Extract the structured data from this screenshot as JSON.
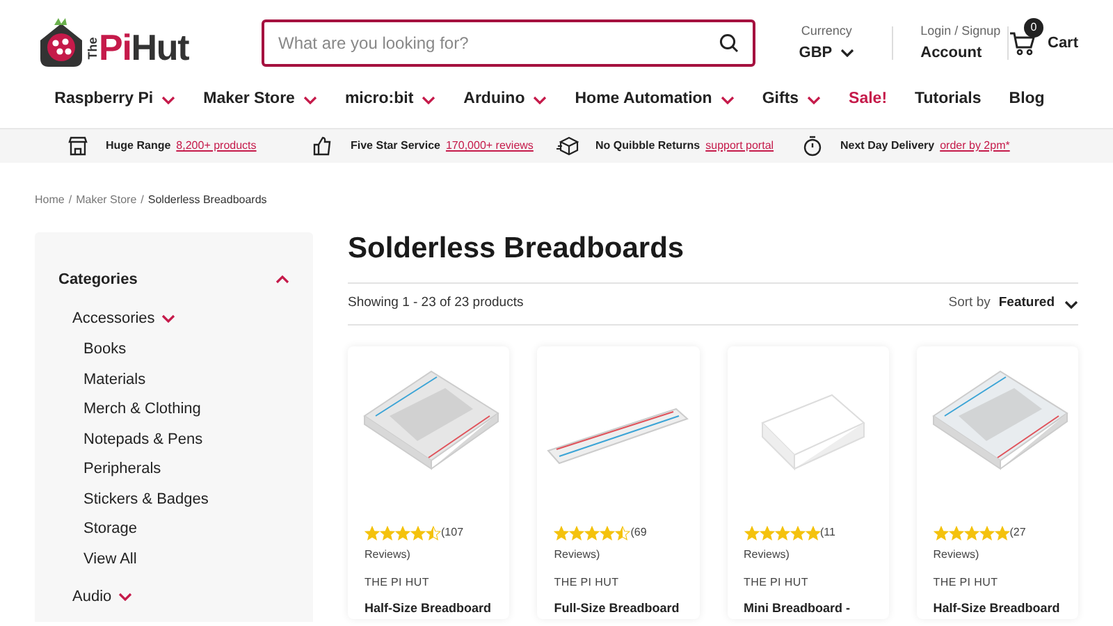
{
  "logo": {
    "prefix": "The",
    "pi": "Pi",
    "hut": "Hut"
  },
  "search": {
    "placeholder": "What are you looking for?"
  },
  "currency": {
    "label": "Currency",
    "value": "GBP"
  },
  "account": {
    "label": "Login / Signup",
    "value": "Account"
  },
  "cart": {
    "count": "0",
    "label": "Cart"
  },
  "nav": [
    {
      "label": "Raspberry Pi",
      "dropdown": true,
      "sale": false
    },
    {
      "label": "Maker Store",
      "dropdown": true,
      "sale": false
    },
    {
      "label": "micro:bit",
      "dropdown": true,
      "sale": false
    },
    {
      "label": "Arduino",
      "dropdown": true,
      "sale": false
    },
    {
      "label": "Home Automation",
      "dropdown": true,
      "sale": false
    },
    {
      "label": "Gifts",
      "dropdown": true,
      "sale": false
    },
    {
      "label": "Sale!",
      "dropdown": false,
      "sale": true
    },
    {
      "label": "Tutorials",
      "dropdown": false,
      "sale": false
    },
    {
      "label": "Blog",
      "dropdown": false,
      "sale": false
    }
  ],
  "usps": [
    {
      "kind": "store",
      "title": "Huge Range",
      "link": "8,200+ products"
    },
    {
      "kind": "thumb",
      "title": "Five Star Service",
      "link": "170,000+ reviews"
    },
    {
      "kind": "box",
      "title": "No Quibble Returns",
      "link": "support portal"
    },
    {
      "kind": "timer",
      "title": "Next Day Delivery",
      "link": "order by 2pm*"
    }
  ],
  "breadcrumb": [
    {
      "label": "Home",
      "separator": "/"
    },
    {
      "label": "Maker Store",
      "separator": "/"
    },
    {
      "label": "Solderless Breadboards"
    }
  ],
  "sidebar": {
    "title": "Categories",
    "expanded": true,
    "items": [
      {
        "label": "Accessories",
        "expanded": true,
        "children": [
          {
            "label": "Books"
          },
          {
            "label": "Materials"
          },
          {
            "label": "Merch & Clothing"
          },
          {
            "label": "Notepads & Pens"
          },
          {
            "label": "Peripherals"
          },
          {
            "label": "Stickers & Badges"
          },
          {
            "label": "Storage"
          },
          {
            "label": "View All"
          }
        ]
      },
      {
        "label": "Audio",
        "expanded": false
      }
    ]
  },
  "page_title": "Solderless Breadboards",
  "result_count": "Showing 1 - 23 of 23 products",
  "sort": {
    "label": "Sort by",
    "value": "Featured"
  },
  "products": [
    {
      "kind": "half",
      "stars": 4.5,
      "reviews": "(107",
      "reviews_2": "Reviews)",
      "brand": "THE PI HUT",
      "name": "Half-Size Breadboard"
    },
    {
      "kind": "full",
      "stars": 4.5,
      "reviews": "(69",
      "reviews_2": "Reviews)",
      "brand": "THE PI HUT",
      "name": "Full-Size Breadboard"
    },
    {
      "kind": "mini",
      "stars": 5,
      "reviews": "(11",
      "reviews_2": "Reviews)",
      "brand": "THE PI HUT",
      "name": "Mini Breadboard -"
    },
    {
      "kind": "clear",
      "stars": 5,
      "reviews": "(27",
      "reviews_2": "Reviews)",
      "brand": "THE PI HUT",
      "name": "Half-Size Breadboard"
    }
  ]
}
